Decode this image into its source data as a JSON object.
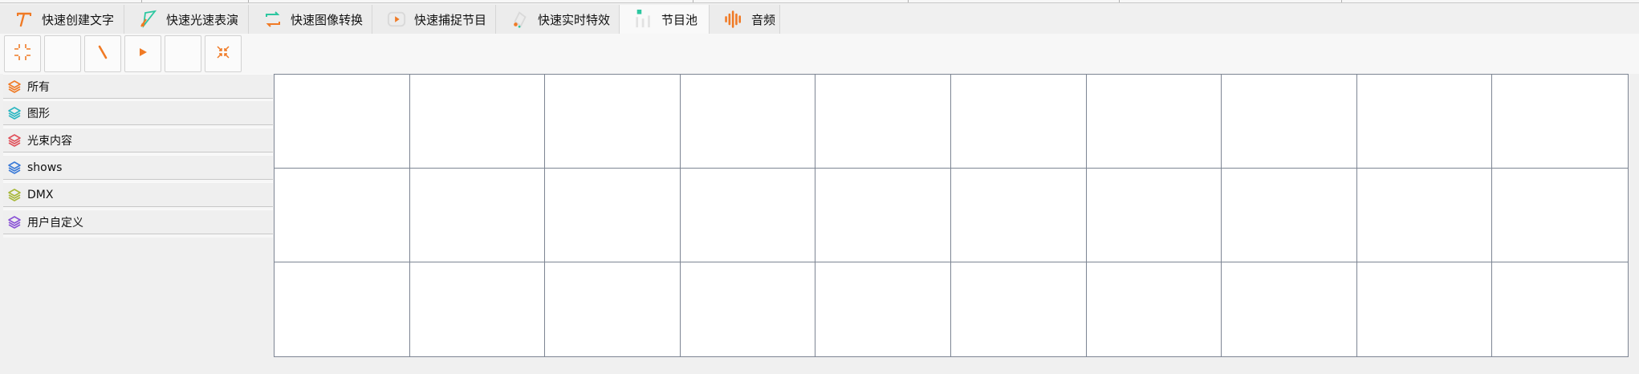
{
  "tabs": [
    {
      "label": "快速创建文字",
      "icon": "text-t-icon"
    },
    {
      "label": "快速光速表演",
      "icon": "beam-triangle-icon"
    },
    {
      "label": "快速图像转换",
      "icon": "image-convert-icon"
    },
    {
      "label": "快速捕捉节目",
      "icon": "capture-play-icon"
    },
    {
      "label": "快速实时特效",
      "icon": "realtime-effect-icon"
    },
    {
      "label": "节目池",
      "icon": "show-pool-icon"
    },
    {
      "label": "音频",
      "icon": "audio-bars-icon"
    }
  ],
  "active_tab": 5,
  "toolbar": {
    "buttons": [
      "collapse-all-icon",
      "blank",
      "line-draw-icon",
      "play-icon",
      "blank",
      "expand-all-icon"
    ]
  },
  "categories": [
    {
      "label": "所有",
      "color": "#f07a25"
    },
    {
      "label": "图形",
      "color": "#2bb6c1"
    },
    {
      "label": "光束内容",
      "color": "#e0505a"
    },
    {
      "label": "shows",
      "color": "#3a7ad8"
    },
    {
      "label": "DMX",
      "color": "#a8b83a"
    },
    {
      "label": "用户自定义",
      "color": "#8a52d6"
    }
  ],
  "grid": {
    "rows": 3,
    "cols": 10
  },
  "colors": {
    "accent": "#f07a25",
    "grid_line": "#7d8593",
    "teal": "#2cc7a0"
  }
}
